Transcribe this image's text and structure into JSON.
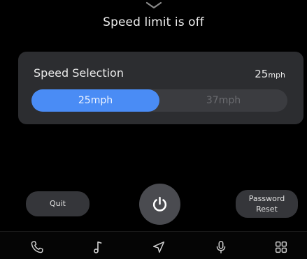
{
  "header": {
    "title": "Speed limit is off",
    "handle_icon": "chevron-down-icon"
  },
  "speed_card": {
    "title": "Speed Selection",
    "current_value": "25",
    "current_unit": "mph",
    "options": [
      {
        "label": "25mph",
        "selected": true
      },
      {
        "label": "37mph",
        "selected": false
      }
    ],
    "accent_color": "#4a8cf5"
  },
  "actions": {
    "quit_label": "Quit",
    "power_icon": "power-icon",
    "password_reset_line1": "Password",
    "password_reset_line2": "Reset"
  },
  "navbar": {
    "items": [
      {
        "icon": "phone-icon"
      },
      {
        "icon": "music-note-icon"
      },
      {
        "icon": "navigation-icon"
      },
      {
        "icon": "microphone-icon"
      },
      {
        "icon": "apps-grid-icon"
      }
    ]
  }
}
